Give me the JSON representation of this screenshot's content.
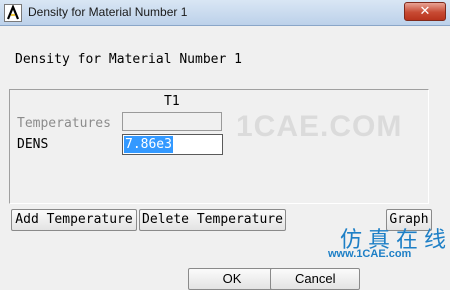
{
  "window": {
    "title": "Density for Material Number 1",
    "close_label": "✕"
  },
  "dialog": {
    "header": "Density for Material Number 1",
    "column_header": "T1",
    "rows": [
      {
        "label": "Temperatures",
        "value": ""
      },
      {
        "label": "DENS",
        "value": "7.86e3"
      }
    ]
  },
  "buttons": {
    "add_temperature": "Add Temperature",
    "delete_temperature": "Delete Temperature",
    "graph": "Graph",
    "ok": "OK",
    "cancel": "Cancel"
  },
  "watermark": {
    "text": "1CAE.COM"
  },
  "logo": {
    "chinese": "仿真在线",
    "url": "www.1CAE.com"
  },
  "colors": {
    "selection": "#3399ff",
    "close_button": "#c74a33",
    "logo": "#1d7fc6"
  }
}
